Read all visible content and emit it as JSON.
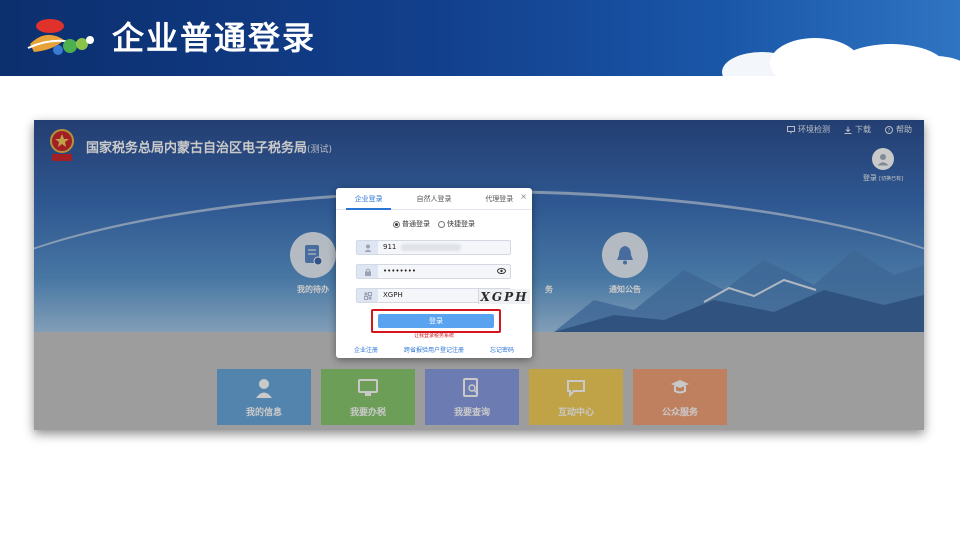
{
  "slide": {
    "title": "企业普通登录"
  },
  "site": {
    "title": "国家税务总局内蒙古自治区电子税务局",
    "subtitle": "(测试)",
    "toplinks": [
      {
        "label": "环境检测",
        "icon": "monitor-icon"
      },
      {
        "label": "下载",
        "icon": "download-icon"
      },
      {
        "label": "帮助",
        "icon": "help-icon"
      }
    ],
    "user": {
      "label": "登录",
      "sub": "[切换已有]"
    }
  },
  "circles": [
    {
      "label": "我的待办",
      "icon": "todo-doc-icon"
    },
    {
      "label": "务",
      "icon": "service-icon"
    },
    {
      "label": "通知公告",
      "icon": "bell-icon"
    }
  ],
  "tiles": [
    {
      "label": "我的信息",
      "color": "#5aa0d8",
      "icon": "user-icon"
    },
    {
      "label": "我要办税",
      "color": "#7ec463",
      "icon": "computer-icon"
    },
    {
      "label": "我要查询",
      "color": "#7f95e0",
      "icon": "search-doc-icon"
    },
    {
      "label": "互动中心",
      "color": "#f3cb4a",
      "icon": "chat-icon"
    },
    {
      "label": "公众服务",
      "color": "#f29a6d",
      "icon": "graduate-icon"
    }
  ],
  "modal": {
    "tabs": [
      "企业登录",
      "自然人登录",
      "代理登录"
    ],
    "active_tab": 0,
    "close": "×",
    "radios": [
      {
        "label": "普通登录",
        "checked": true
      },
      {
        "label": "快捷登录",
        "checked": false
      }
    ],
    "username_value": "911",
    "password_value": "••••••••",
    "captcha_value": "XGPH",
    "captcha_image_text": "XGPH",
    "login_button": "登录",
    "hint": "让我登录税务系统",
    "links": [
      "企业注册",
      "跨省报验用户登记注册",
      "忘记密码"
    ]
  },
  "colors": {
    "header_dark": "#0c2f6e",
    "accent_blue": "#2a74d6",
    "highlight_red": "#d6151c"
  }
}
